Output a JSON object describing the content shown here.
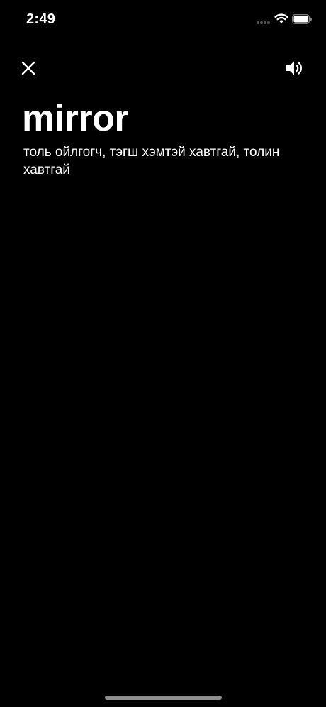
{
  "status_bar": {
    "time": "2:49"
  },
  "icons": {
    "close": "close-icon",
    "speaker": "speaker-icon",
    "wifi": "wifi-icon",
    "battery": "battery-icon",
    "cellular": "cellular-signal-icon"
  },
  "word": {
    "term": "mirror",
    "definition": "толь ойлгогч, тэгш хэмтэй хавтгай, толин хавтгай"
  },
  "colors": {
    "background": "#000000",
    "text": "#ffffff",
    "home_indicator": "#8e8e8e"
  }
}
